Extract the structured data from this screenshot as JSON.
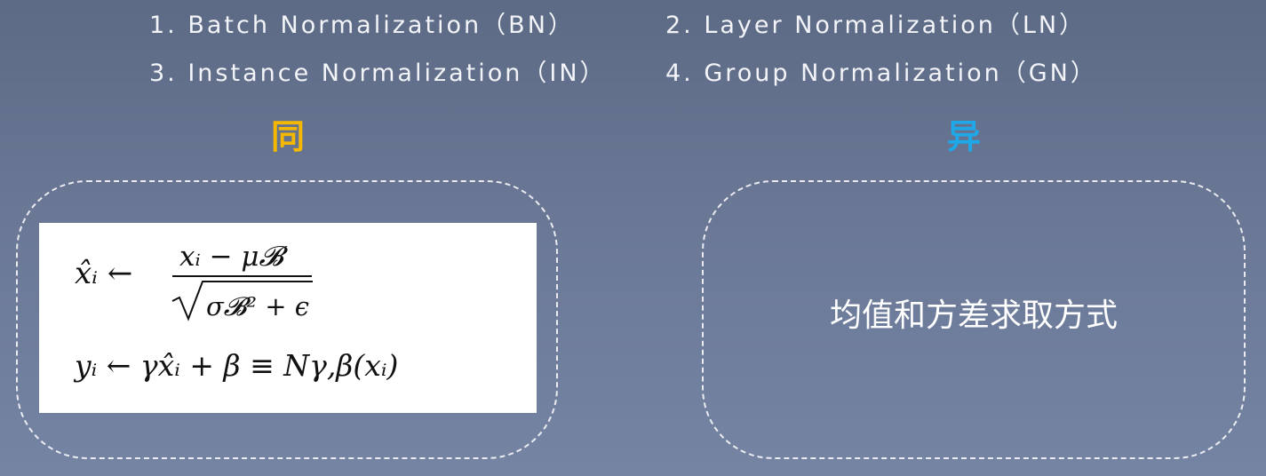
{
  "methods": [
    "1. Batch Normalization（BN）",
    "2. Layer Normalization（LN）",
    "3. Instance Normalization（IN）",
    "4. Group Normalization（GN）"
  ],
  "same": {
    "label": "同",
    "color": "#f5b800",
    "formula": {
      "line1_lhs": "x̂ᵢ ←",
      "line1_numerator": "xᵢ − μ𝓑",
      "line1_denominator": "σ𝓑² + ϵ",
      "line2": "yᵢ ← γx̂ᵢ + β ≡ Nγ,β(xᵢ)"
    }
  },
  "different": {
    "label": "异",
    "color": "#1fa8e8",
    "text": "均值和方差求取方式"
  }
}
